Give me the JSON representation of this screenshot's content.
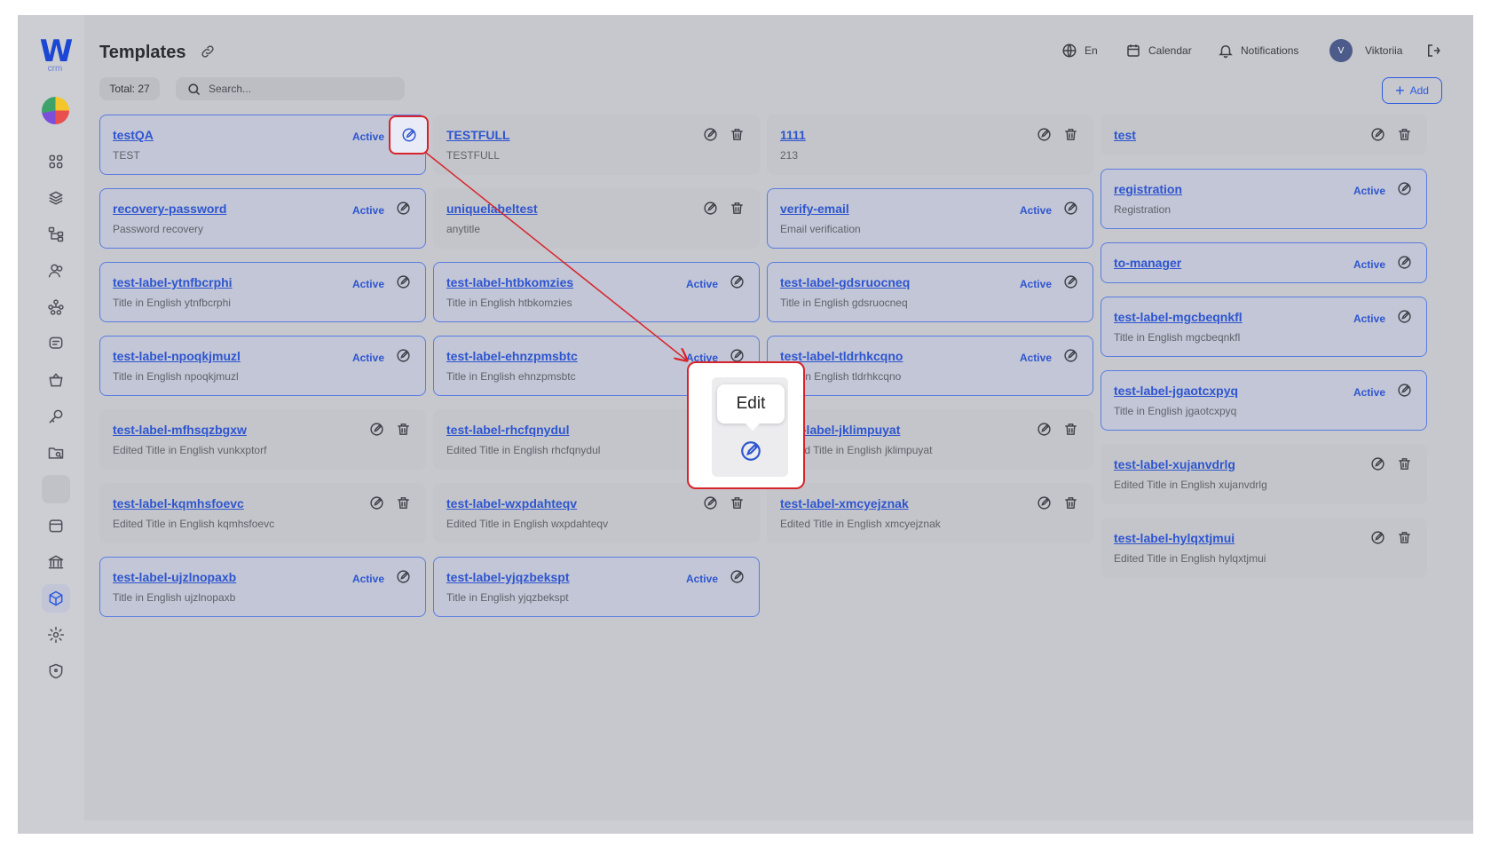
{
  "app": {
    "logo_text": "W",
    "logo_sub": "crm"
  },
  "sidebar": {
    "items": [
      {
        "icon": "grid-icon"
      },
      {
        "icon": "layers-icon"
      },
      {
        "icon": "hierarchy-icon"
      },
      {
        "icon": "users-icon"
      },
      {
        "icon": "network-icon"
      },
      {
        "icon": "chat-icon"
      },
      {
        "icon": "basket-icon"
      },
      {
        "icon": "key-icon"
      },
      {
        "icon": "folder-search-icon"
      },
      {
        "icon": "blank-icon"
      },
      {
        "icon": "calendar-box-icon"
      },
      {
        "icon": "bank-icon"
      },
      {
        "icon": "cube-icon",
        "active": true
      },
      {
        "icon": "gear-icon"
      },
      {
        "icon": "shield-icon"
      }
    ]
  },
  "header": {
    "title": "Templates",
    "language": "En",
    "calendar": "Calendar",
    "notifications": "Notifications",
    "user_initial": "V",
    "user_name": "Viktoriia"
  },
  "toolbar": {
    "total": "Total: 27",
    "search_placeholder": "Search...",
    "add_label": "Add"
  },
  "columns": [
    [
      {
        "label": "testQA",
        "title": "TEST",
        "active": true
      },
      {
        "label": "recovery-password",
        "title": "Password recovery",
        "active": true
      },
      {
        "label": "test-label-ytnfbcrphi",
        "title": "Title in English ytnfbcrphi",
        "active": true
      },
      {
        "label": "test-label-npoqkjmuzl",
        "title": "Title in English npoqkjmuzl",
        "active": true
      },
      {
        "label": "test-label-mfhsqzbgxw",
        "title": "Edited Title in English vunkxptorf",
        "active": false
      },
      {
        "label": "test-label-kqmhsfoevc",
        "title": "Edited Title in English kqmhsfoevc",
        "active": false
      },
      {
        "label": "test-label-ujzlnopaxb",
        "title": "Title in English ujzlnopaxb",
        "active": true
      }
    ],
    [
      {
        "label": "TESTFULL",
        "title": "TESTFULL",
        "active": false
      },
      {
        "label": "uniquelabeltest",
        "title": "anytitle",
        "active": false
      },
      {
        "label": "test-label-htbkomzies",
        "title": "Title in English htbkomzies",
        "active": true
      },
      {
        "label": "test-label-ehnzpmsbtc",
        "title": "Title in English ehnzpmsbtc",
        "active": true
      },
      {
        "label": "test-label-rhcfqnydul",
        "title": "Edited Title in English rhcfqnydul",
        "active": false
      },
      {
        "label": "test-label-wxpdahteqv",
        "title": "Edited Title in English wxpdahteqv",
        "active": false
      },
      {
        "label": "test-label-yjqzbekspt",
        "title": "Title in English yjqzbekspt",
        "active": true
      }
    ],
    [
      {
        "label": "1111",
        "title": "213",
        "active": false
      },
      {
        "label": "verify-email",
        "title": "Email verification",
        "active": true
      },
      {
        "label": "test-label-gdsruocneq",
        "title": "Title in English gdsruocneq",
        "active": true
      },
      {
        "label": "test-label-tldrhkcqno",
        "title": "Title in English tldrhkcqno",
        "active": true
      },
      {
        "label": "test-label-jklimpuyat",
        "title": "Edited Title in English jklimpuyat",
        "active": false
      },
      {
        "label": "test-label-xmcyejznak",
        "title": "Edited Title in English xmcyejznak",
        "active": false
      }
    ],
    [
      {
        "label": "test",
        "title": "",
        "active": false,
        "compact": true
      },
      {
        "label": "registration",
        "title": "Registration",
        "active": true
      },
      {
        "label": "to-manager",
        "title": "",
        "active": true,
        "compact": true
      },
      {
        "label": "test-label-mgcbeqnkfl",
        "title": "Title in English mgcbeqnkfl",
        "active": true
      },
      {
        "label": "test-label-jgaotcxpyq",
        "title": "Title in English jgaotcxpyq",
        "active": true
      },
      {
        "label": "test-label-xujanvdrlg",
        "title": "Edited Title in English xujanvdrlg",
        "active": false
      },
      {
        "label": "test-label-hylqxtjmui",
        "title": "Edited Title in English hylqxtjmui",
        "active": false
      }
    ]
  ],
  "status_text": "Active",
  "tooltip": {
    "text": "Edit"
  },
  "colors": {
    "accent": "#2e55d0",
    "highlight": "#d8232a"
  }
}
